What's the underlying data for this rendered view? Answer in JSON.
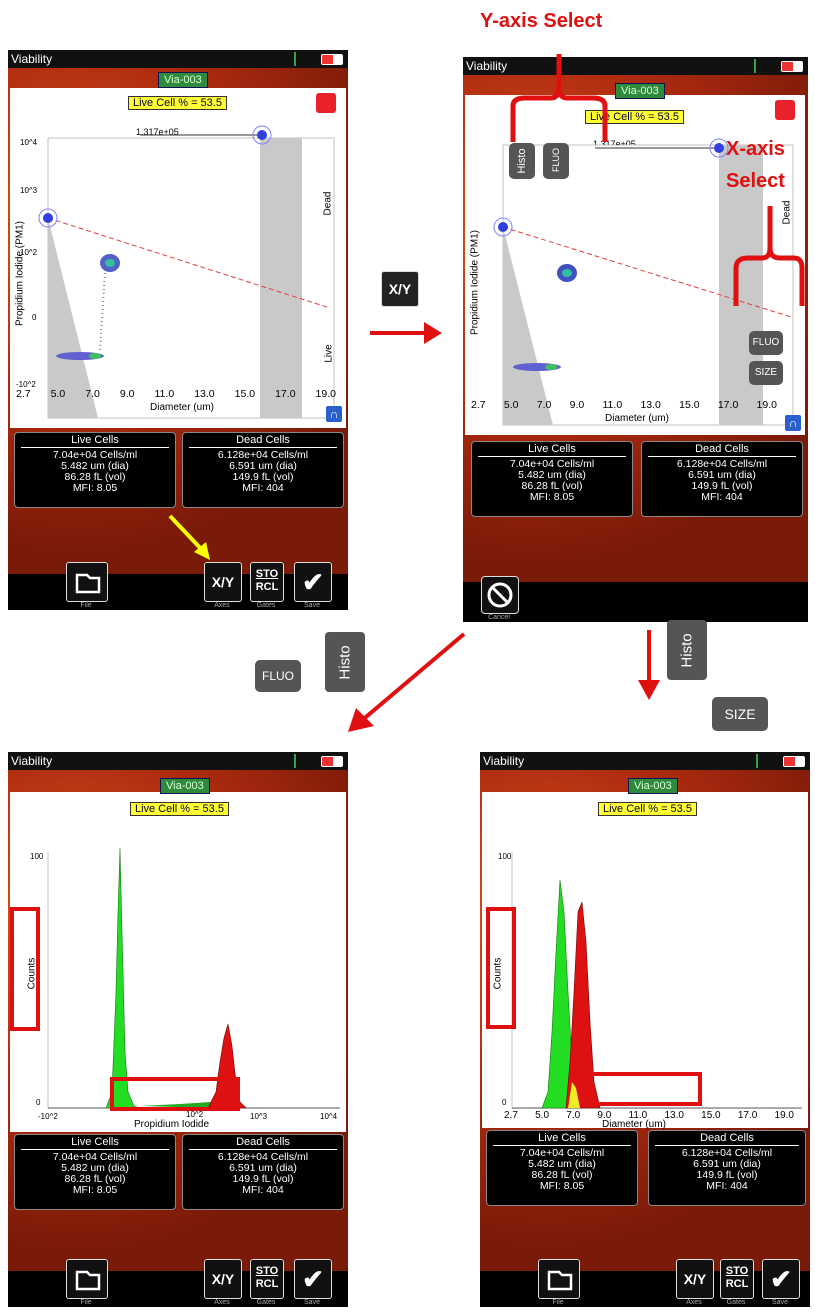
{
  "app_title": "Viability",
  "sample_tag": "Via-003",
  "live_cell_percent_label": "Live Cell % = 53.5",
  "gate_value": "1.317e+05",
  "scatter": {
    "y_label": "Propidium Iodide (PM1)",
    "x_label": "Diameter (um)",
    "x_ticks": [
      "2.7",
      "5.0",
      "7.0",
      "9.0",
      "11.0",
      "13.0",
      "15.0",
      "17.0",
      "19.0"
    ],
    "y_ticks": [
      "10^4",
      "10^3",
      "10^2",
      "0",
      "-10^2"
    ],
    "dead_label": "Dead",
    "live_label": "Live"
  },
  "live_cells": {
    "title": "Live Cells",
    "conc": "7.04e+04 Cells/ml",
    "dia": "5.482 um (dia)",
    "vol": "86.28 fL (vol)",
    "mfi": "MFI: 8.05"
  },
  "dead_cells": {
    "title": "Dead Cells",
    "conc": "6.128e+04 Cells/ml",
    "dia": "6.591 um (dia)",
    "vol": "149.9 fL (vol)",
    "mfi": "MFI: 404"
  },
  "toolbar": {
    "file": "File",
    "axes": "Axes",
    "gates": "Gates",
    "save": "Save",
    "xy": "X/Y",
    "sto": "STO",
    "rcl": "RCL",
    "cancel": "Cancel"
  },
  "annotations": {
    "y_axis_select": "Y-axis Select",
    "x_axis_select_1": "X-axis",
    "x_axis_select_2": "Select",
    "xy_button": "X/Y",
    "histo": "Histo",
    "fluo": "FLUO",
    "size": "SIZE"
  },
  "histo_pi": {
    "y_label": "Counts",
    "x_label": "Propidium Iodide",
    "y_max": "100",
    "y_zero": "0",
    "x_ticks": [
      "-10^2",
      "10^2",
      "10^3",
      "10^4"
    ]
  },
  "histo_size": {
    "y_label": "Counts",
    "x_label": "Diameter (um)",
    "y_max": "100",
    "y_zero": "0",
    "x_ticks": [
      "2.7",
      "5.0",
      "7.0",
      "9.0",
      "11.0",
      "13.0",
      "15.0",
      "17.0",
      "19.0"
    ]
  },
  "colors": {
    "accent_red": "#e01010",
    "live_green": "#22dd22",
    "dead_red": "#dd1111",
    "overlap_yellow": "#eeee22"
  }
}
